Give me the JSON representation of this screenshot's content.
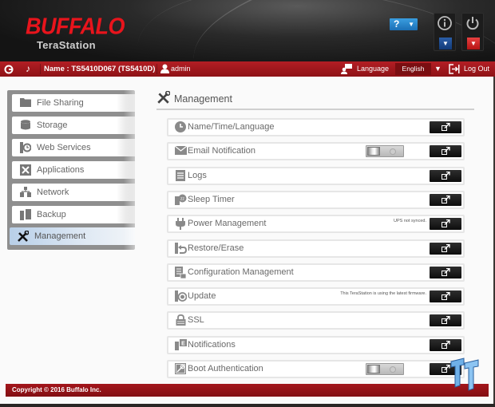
{
  "header": {
    "brand": "BUFFALO",
    "product": "TeraStation",
    "help_label": "?",
    "icons": {
      "help": "question-icon",
      "info": "info-icon",
      "power": "power-icon"
    }
  },
  "topbar": {
    "name_label": "Name : TS5410D067 (TS5410D)",
    "user": "admin",
    "language_label": "Language",
    "language_value": "English",
    "logout_label": "Log Out"
  },
  "sidebar": {
    "items": [
      {
        "label": "File Sharing",
        "icon": "folder-icon",
        "active": false
      },
      {
        "label": "Storage",
        "icon": "database-icon",
        "active": false
      },
      {
        "label": "Web Services",
        "icon": "web-services-icon",
        "active": false
      },
      {
        "label": "Applications",
        "icon": "applications-icon",
        "active": false
      },
      {
        "label": "Network",
        "icon": "network-icon",
        "active": false
      },
      {
        "label": "Backup",
        "icon": "backup-icon",
        "active": false
      },
      {
        "label": "Management",
        "icon": "tools-icon",
        "active": true
      }
    ]
  },
  "main": {
    "title": "Management",
    "rows": [
      {
        "label": "Name/Time/Language",
        "icon": "clock-icon",
        "note": "",
        "toggle": false
      },
      {
        "label": "Email Notification",
        "icon": "envelope-icon",
        "note": "",
        "toggle": true,
        "toggle_state": "off"
      },
      {
        "label": "Logs",
        "icon": "logs-icon",
        "note": "",
        "toggle": false
      },
      {
        "label": "Sleep Timer",
        "icon": "sleep-timer-icon",
        "note": "",
        "toggle": false
      },
      {
        "label": "Power Management",
        "icon": "plug-icon",
        "note": "UPS not synced.",
        "toggle": false
      },
      {
        "label": "Restore/Erase",
        "icon": "restore-icon",
        "note": "",
        "toggle": false
      },
      {
        "label": "Configuration Management",
        "icon": "configuration-icon",
        "note": "",
        "toggle": false
      },
      {
        "label": "Update",
        "icon": "update-icon",
        "note": "This TeraStation is using the latest firmware.",
        "toggle": false
      },
      {
        "label": "SSL",
        "icon": "lock-icon",
        "note": "",
        "toggle": false
      },
      {
        "label": "Notifications",
        "icon": "notifications-icon",
        "note": "",
        "toggle": false
      },
      {
        "label": "Boot Authentication",
        "icon": "boot-auth-icon",
        "note": "",
        "toggle": true,
        "toggle_state": "off"
      }
    ]
  },
  "footer": {
    "copyright": "Copyright © 2016 Buffalo Inc."
  },
  "colors": {
    "brand_red": "#e8141c",
    "bar_red": "#a3161c",
    "help_blue": "#1b6fb5",
    "active_item": "#b8cfe8"
  }
}
